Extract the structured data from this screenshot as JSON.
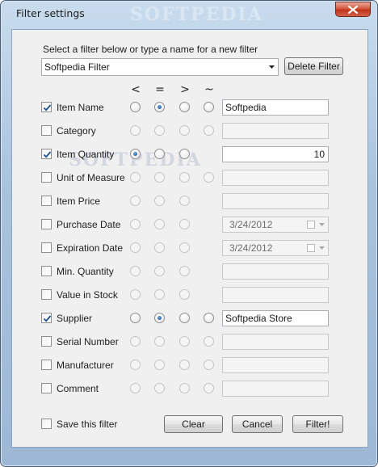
{
  "window": {
    "title": "Filter settings",
    "watermark": "SOFTPEDIA"
  },
  "prompt": "Select a filter below or type a name for a new filter",
  "filter_select": {
    "value": "Softpedia Filter"
  },
  "buttons": {
    "delete": "Delete Filter",
    "clear": "Clear",
    "cancel": "Cancel",
    "filter": "Filter!"
  },
  "operators": [
    "<",
    "=",
    ">",
    "~"
  ],
  "rows": [
    {
      "label": "Item Name",
      "checked": true,
      "ops": 4,
      "selected": 1,
      "value": "Softpedia",
      "kind": "text",
      "enabled": true
    },
    {
      "label": "Category",
      "checked": false,
      "ops": 4,
      "selected": -1,
      "value": "",
      "kind": "text",
      "enabled": false
    },
    {
      "label": "Item Quantity",
      "checked": true,
      "ops": 3,
      "selected": 0,
      "value": "10",
      "kind": "number",
      "enabled": true
    },
    {
      "label": "Unit of Measure",
      "checked": false,
      "ops": 4,
      "selected": -1,
      "value": "",
      "kind": "text",
      "enabled": false
    },
    {
      "label": "Item Price",
      "checked": false,
      "ops": 3,
      "selected": -1,
      "value": "",
      "kind": "text",
      "enabled": false
    },
    {
      "label": "Purchase Date",
      "checked": false,
      "ops": 3,
      "selected": -1,
      "value": "3/24/2012",
      "kind": "date",
      "enabled": false
    },
    {
      "label": "Expiration Date",
      "checked": false,
      "ops": 3,
      "selected": -1,
      "value": "3/24/2012",
      "kind": "date",
      "enabled": false
    },
    {
      "label": "Min. Quantity",
      "checked": false,
      "ops": 3,
      "selected": -1,
      "value": "",
      "kind": "text",
      "enabled": false
    },
    {
      "label": "Value in Stock",
      "checked": false,
      "ops": 3,
      "selected": -1,
      "value": "",
      "kind": "text",
      "enabled": false
    },
    {
      "label": "Supplier",
      "checked": true,
      "ops": 4,
      "selected": 1,
      "value": "Softpedia Store",
      "kind": "text",
      "enabled": true
    },
    {
      "label": "Serial Number",
      "checked": false,
      "ops": 4,
      "selected": -1,
      "value": "",
      "kind": "text",
      "enabled": false
    },
    {
      "label": "Manufacturer",
      "checked": false,
      "ops": 4,
      "selected": -1,
      "value": "",
      "kind": "text",
      "enabled": false
    },
    {
      "label": "Comment",
      "checked": false,
      "ops": 4,
      "selected": -1,
      "value": "",
      "kind": "text",
      "enabled": false
    }
  ],
  "save_filter": {
    "label": "Save this filter",
    "checked": false
  },
  "icons": {
    "close": "close-icon",
    "dropdown": "chevron-down-icon",
    "check": "check-icon",
    "calendar": "calendar-icon"
  },
  "colors": {
    "title_bar": "#a9c3de",
    "close_button": "#c0321a",
    "client_bg": "#f0f0f0"
  }
}
